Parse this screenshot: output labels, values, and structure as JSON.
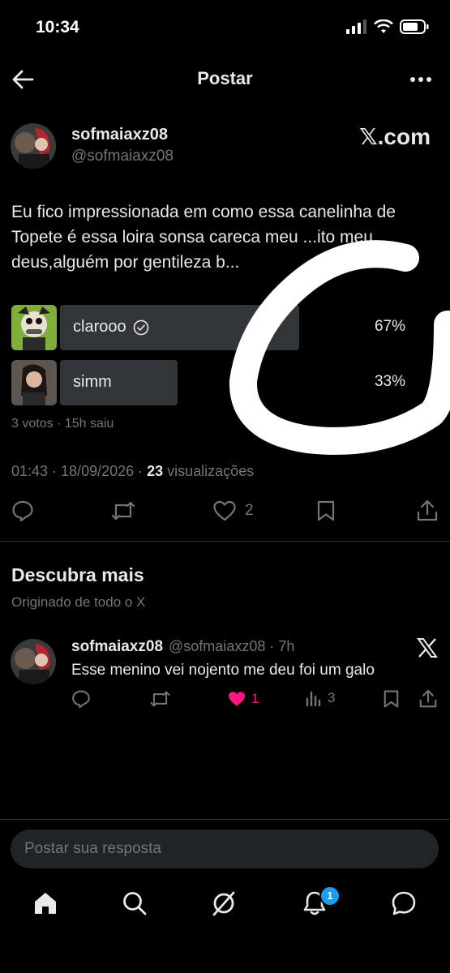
{
  "status_bar": {
    "time": "10:34"
  },
  "header": {
    "title": "Postar"
  },
  "post": {
    "display_name": "sofmaiaxz08",
    "handle": "@sofmaiaxz08",
    "watermark": "𝕏.com",
    "text": "Eu fico impressionada em como essa canelinha de Topete é essa loira sonsa careca meu ...ito meu deus,alguém por gentileza b...",
    "poll": {
      "options": [
        {
          "label": "clarooo",
          "percent": "67%",
          "value": 0.67,
          "winner": true
        },
        {
          "label": "simm",
          "percent": "33%",
          "value": 0.33,
          "winner": false
        }
      ],
      "summary": "3 votos · 15h saiu"
    },
    "timestamp": "01:43 · 18/09/2026 · ",
    "views_count": "23",
    "views_label": " visualizações",
    "likes": "2"
  },
  "discover": {
    "title": "Descubra mais",
    "subtitle": "Originado de todo o X",
    "tweet": {
      "display_name": "sofmaiaxz08",
      "handle_time": "@sofmaiaxz08 · 7h",
      "text": "Esse menino vei  nojento me deu foi um galo",
      "likes": "1",
      "views": "3"
    }
  },
  "reply": {
    "placeholder": "Postar sua resposta"
  },
  "nav": {
    "notifications_badge": "1"
  },
  "colors": {
    "accent": "#1d9bf0",
    "like": "#f91880",
    "background": "#000000"
  }
}
